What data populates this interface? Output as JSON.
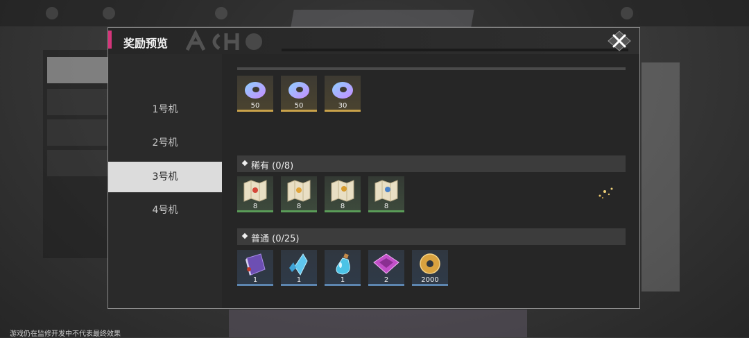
{
  "modal": {
    "title": "奖励预览"
  },
  "tabs": [
    {
      "label": "1号机",
      "active": false
    },
    {
      "label": "2号机",
      "active": false
    },
    {
      "label": "3号机",
      "active": true
    },
    {
      "label": "4号机",
      "active": false
    }
  ],
  "sections": {
    "top": {
      "items": [
        {
          "icon": "ring-disc-icon",
          "count": "50",
          "rarity": "gold"
        },
        {
          "icon": "ring-disc-icon",
          "count": "50",
          "rarity": "gold"
        },
        {
          "icon": "ring-disc-icon",
          "count": "30",
          "rarity": "gold"
        }
      ]
    },
    "rare": {
      "label": "稀有 (0/8)",
      "items": [
        {
          "icon": "map-scroll-red-icon",
          "count": "8",
          "rarity": "green"
        },
        {
          "icon": "map-scroll-gold-icon",
          "count": "8",
          "rarity": "green"
        },
        {
          "icon": "map-scroll-amber-icon",
          "count": "8",
          "rarity": "green"
        },
        {
          "icon": "map-scroll-blue-icon",
          "count": "8",
          "rarity": "green"
        }
      ]
    },
    "common": {
      "label": "普通 (0/25)",
      "items": [
        {
          "icon": "book-icon",
          "count": "1",
          "rarity": "blue"
        },
        {
          "icon": "crystal-icon",
          "count": "1",
          "rarity": "blue"
        },
        {
          "icon": "potion-icon",
          "count": "1",
          "rarity": "blue"
        },
        {
          "icon": "gem-box-icon",
          "count": "2",
          "rarity": "blue"
        },
        {
          "icon": "coin-icon",
          "count": "2000",
          "rarity": "blue"
        }
      ]
    }
  },
  "footer": {
    "note": "游戏仍在监修开发中不代表最终效果"
  },
  "colors": {
    "accent": "#d4357a",
    "gold": "#c9a24a",
    "green": "#5a9c58",
    "blue": "#5d86b0"
  }
}
